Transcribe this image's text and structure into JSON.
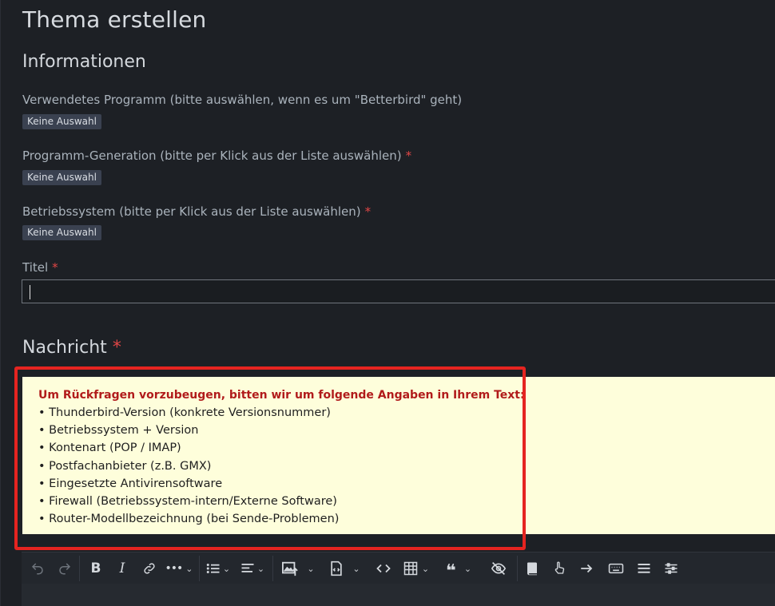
{
  "page": {
    "title": "Thema erstellen"
  },
  "information": {
    "heading": "Informationen",
    "fields": [
      {
        "label": "Verwendetes Programm (bitte auswählen, wenn es um \"Betterbird\" geht)",
        "required": false,
        "value": "Keine Auswahl"
      },
      {
        "label": "Programm-Generation (bitte per Klick aus der Liste auswählen)",
        "required": true,
        "value": "Keine Auswahl"
      },
      {
        "label": "Betriebssystem (bitte per Klick aus der Liste auswählen)",
        "required": true,
        "value": "Keine Auswahl"
      }
    ],
    "title_field": {
      "label": "Titel",
      "required": true,
      "value": ""
    },
    "required_marker": "*"
  },
  "message": {
    "heading": "Nachricht",
    "required_marker": "*",
    "notice_heading": "Um Rückfragen vorzubeugen, bitten wir um folgende Angaben in Ihrem Text:",
    "notice_items": [
      "• Thunderbird-Version (konkrete Versionsnummer)",
      "• Betriebssystem + Version",
      "• Kontenart (POP / IMAP)",
      "• Postfachanbieter (z.B. GMX)",
      "• Eingesetzte Antivirensoftware",
      "• Firewall (Betriebssystem-intern/Externe Software)",
      "• Router-Modellbezeichnung (bei Sende-Problemen)"
    ]
  },
  "toolbar": {
    "buttons": [
      "undo-icon",
      "redo-icon",
      "bold-icon",
      "italic-icon",
      "link-icon",
      "more-icon",
      "list-icon",
      "align-icon",
      "insert-image-icon",
      "insert-template-icon",
      "code-icon",
      "table-icon",
      "quote-icon",
      "hide-icon",
      "book-icon",
      "hand-pointer-icon",
      "arrow-right-icon",
      "keyboard-icon",
      "menu-icon",
      "settings-sliders-icon"
    ]
  },
  "colors": {
    "required": "#e04646",
    "highlight": "#e52420",
    "notice_bg": "#fefedb",
    "notice_heading": "#b11b1b"
  }
}
